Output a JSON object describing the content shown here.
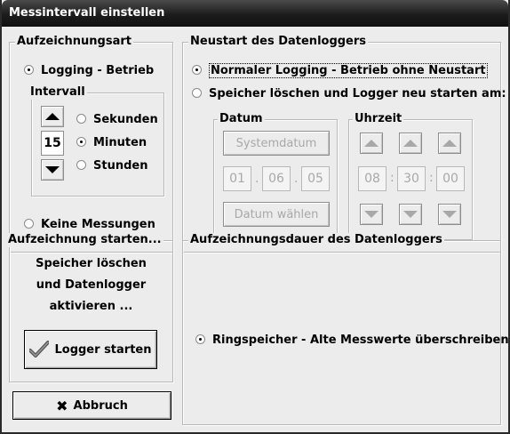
{
  "window": {
    "title": "Messintervall einstellen"
  },
  "aufzeichnungsart": {
    "label": "Aufzeichnungsart",
    "logging_label": "Logging - Betrieb",
    "keine_label": "Keine Messungen",
    "intervall": {
      "label": "Intervall",
      "value": "15",
      "sekunden": "Sekunden",
      "minuten": "Minuten",
      "stunden": "Stunden"
    }
  },
  "neustart": {
    "label": "Neustart des Datenloggers",
    "normal_label": "Normaler Logging - Betrieb ohne Neustart",
    "speicher_label": "Speicher löschen und Logger neu starten am:",
    "datum": {
      "label": "Datum",
      "systemdatum": "Systemdatum",
      "day": "01",
      "month": "06",
      "year": "05",
      "sep": ".",
      "waehlen": "Datum wählen"
    },
    "uhrzeit": {
      "label": "Uhrzeit",
      "hour": "08",
      "minute": "30",
      "second": "00",
      "sep": ":"
    }
  },
  "aufzeichnung_starten": {
    "label": "Aufzeichnung starten...",
    "text1": "Speicher löschen",
    "text2": "und Datenlogger",
    "text3": "aktivieren ...",
    "button": "Logger starten"
  },
  "dauer": {
    "label": "Aufzeichnungsdauer des Datenloggers",
    "ring_label": "Ringspeicher - Alte Messwerte überschreiben"
  },
  "abbruch": {
    "label": "Abbruch"
  }
}
